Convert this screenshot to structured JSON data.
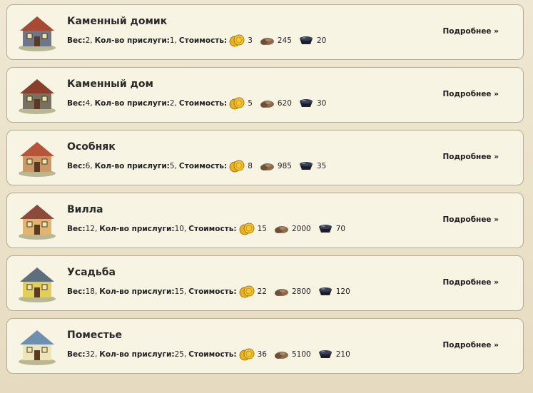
{
  "labels": {
    "weight": "Вес:",
    "servants": "Кол-во прислуги:",
    "cost": "Стоимость:",
    "more": "Подробнее »"
  },
  "icons": {
    "gold": "gold-coins-icon",
    "stone": "stone-icon",
    "coal": "coal-cart-icon"
  },
  "items": [
    {
      "name": "Каменный домик",
      "weight": "2",
      "servants": "1",
      "gold": "3",
      "stone": "245",
      "coal": "20",
      "roof": "#a84a33",
      "wall": "#6f7688"
    },
    {
      "name": "Каменный дом",
      "weight": "4",
      "servants": "2",
      "gold": "5",
      "stone": "620",
      "coal": "30",
      "roof": "#8a3f2b",
      "wall": "#7a705f"
    },
    {
      "name": "Особняк",
      "weight": "6",
      "servants": "5",
      "gold": "8",
      "stone": "985",
      "coal": "35",
      "roof": "#b7553a",
      "wall": "#c99a66"
    },
    {
      "name": "Вилла",
      "weight": "12",
      "servants": "10",
      "gold": "15",
      "stone": "2000",
      "coal": "70",
      "roof": "#8c4a3a",
      "wall": "#e1b56f"
    },
    {
      "name": "Усадьба",
      "weight": "18",
      "servants": "15",
      "gold": "22",
      "stone": "2800",
      "coal": "120",
      "roof": "#5f6e7d",
      "wall": "#e2cf5a"
    },
    {
      "name": "Поместье",
      "weight": "32",
      "servants": "25",
      "gold": "36",
      "stone": "5100",
      "coal": "210",
      "roof": "#6e8fb0",
      "wall": "#efe3b8"
    }
  ]
}
